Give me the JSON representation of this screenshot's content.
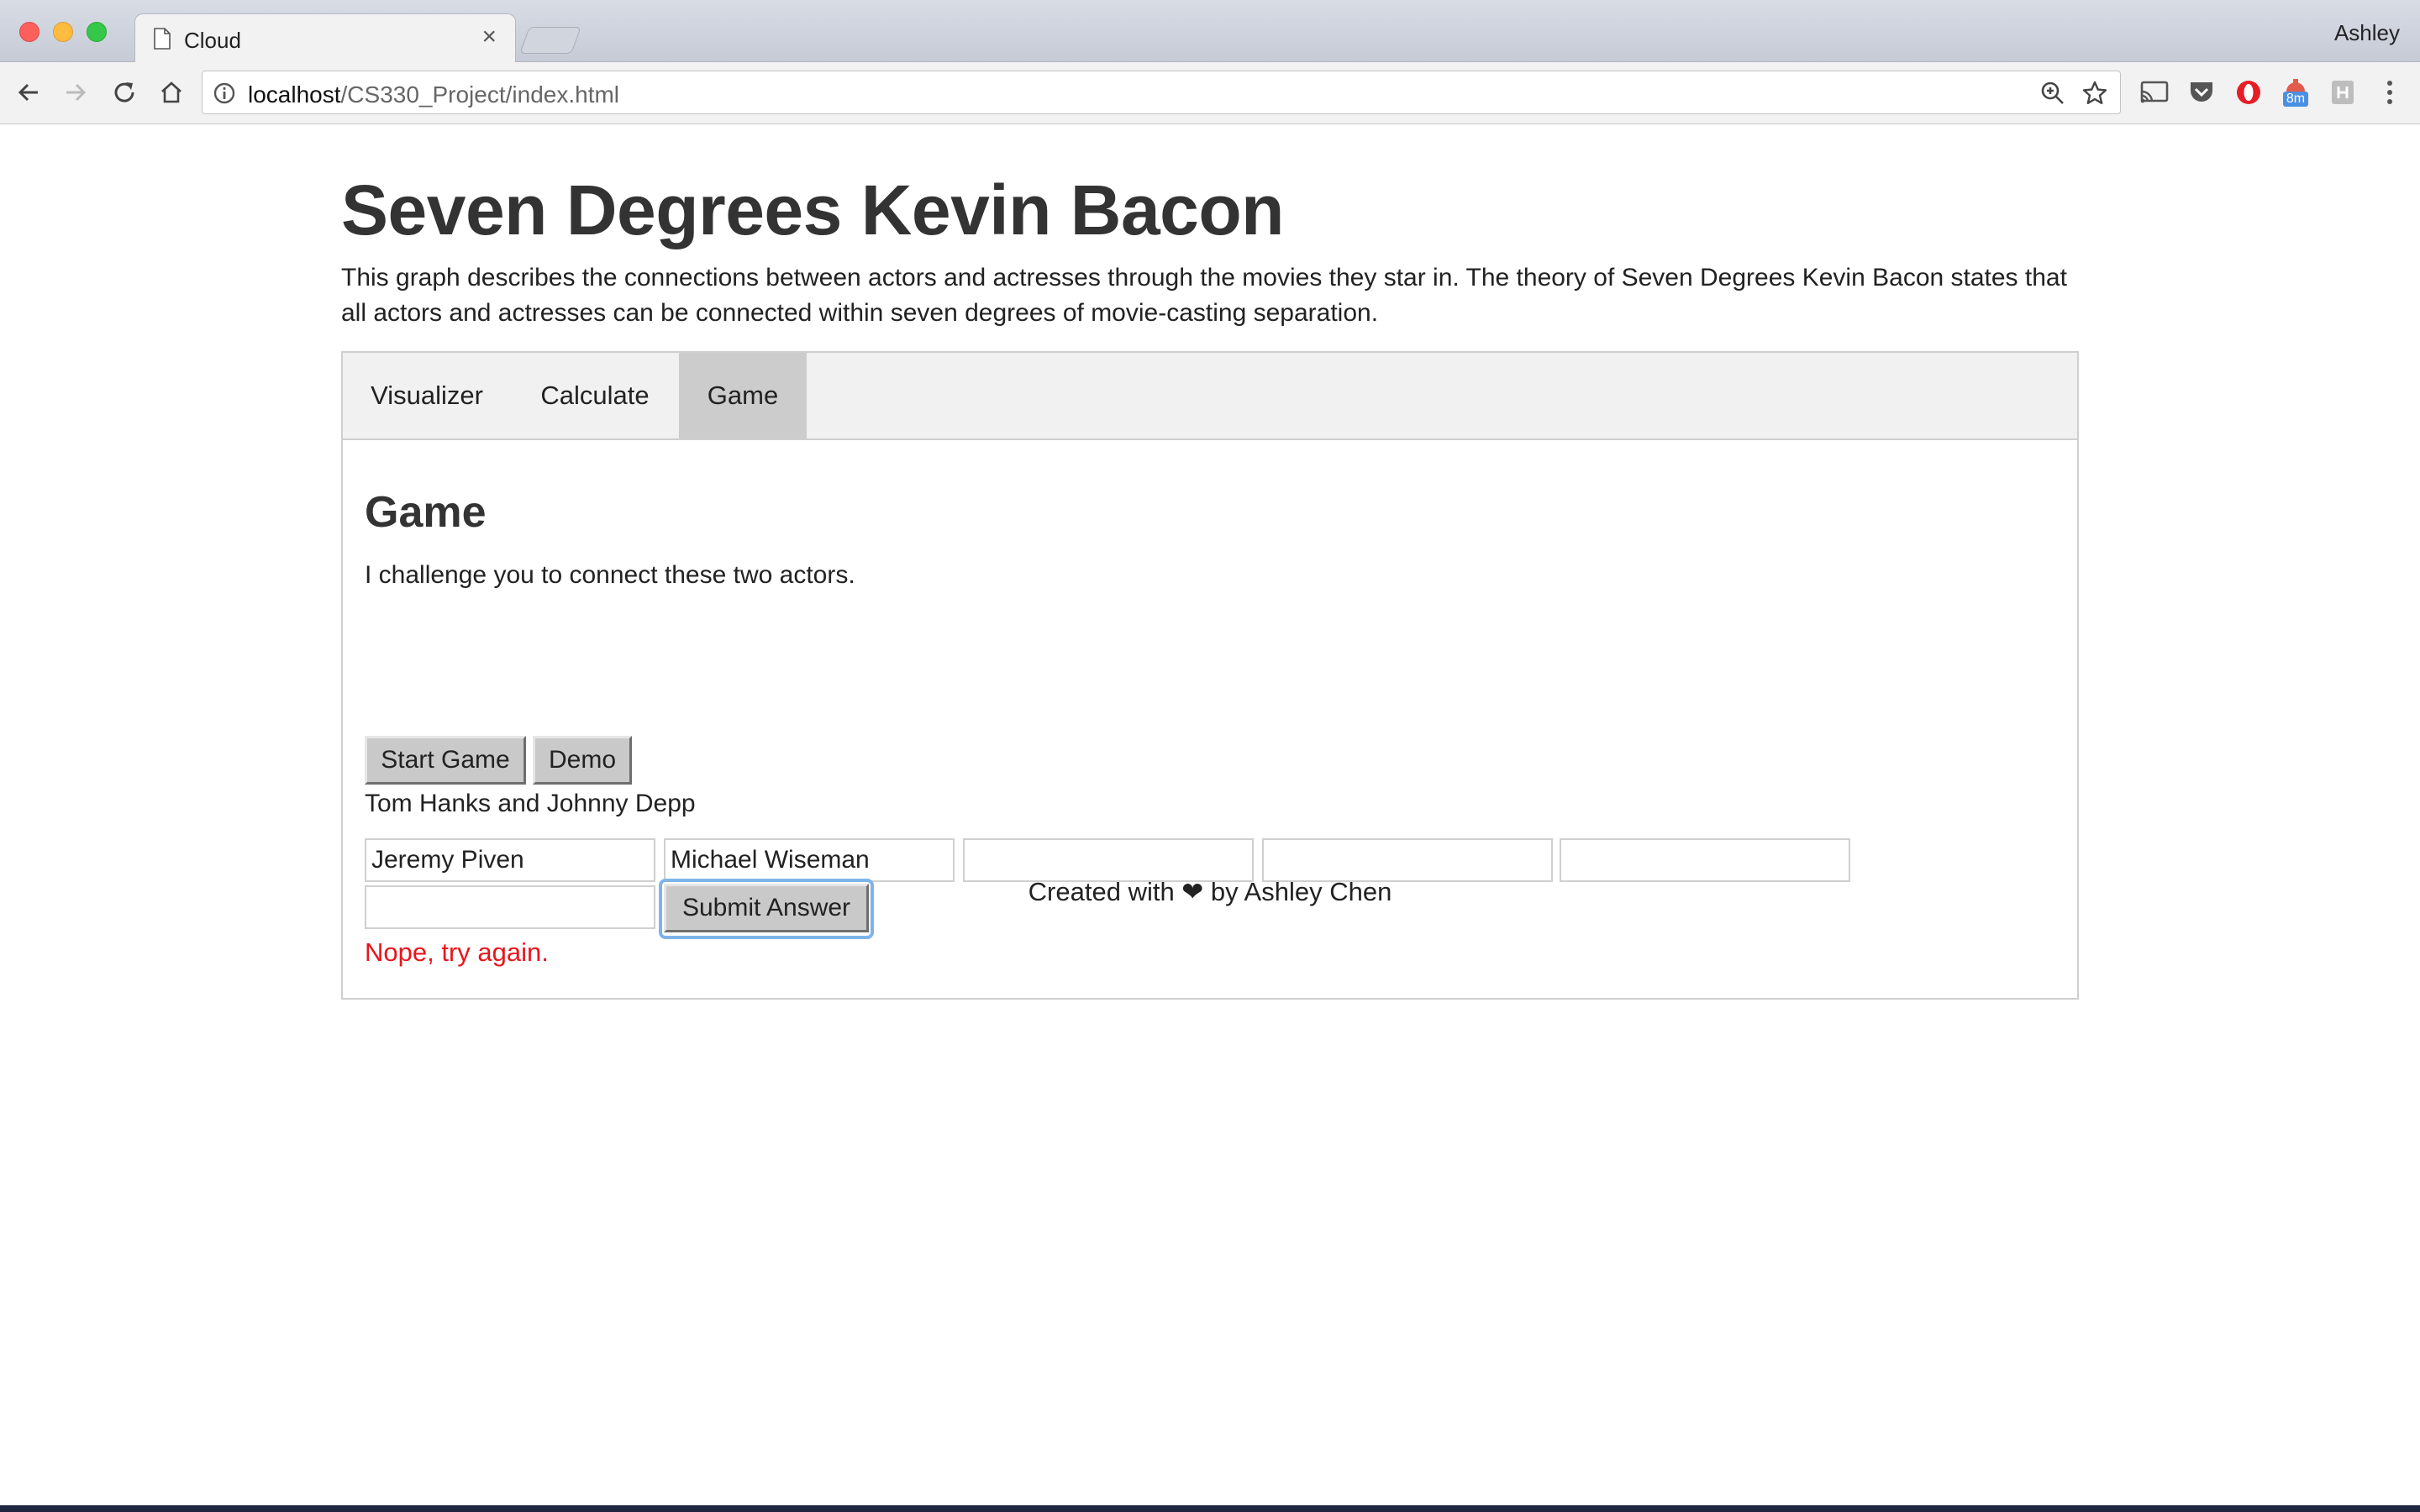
{
  "browser": {
    "tab_title": "Cloud",
    "tab_close": "×",
    "profile_name": "Ashley",
    "url_host": "localhost",
    "url_path": "/CS330_Project/index.html",
    "extension_badge": "8m",
    "badge_color": "#4a90e2"
  },
  "page": {
    "title": "Seven Degrees Kevin Bacon",
    "intro": "This graph describes the connections between actors and actresses through the movies they star in. The theory of Seven Degrees Kevin Bacon states that all actors and actresses can be connected within seven degrees of movie-casting separation.",
    "tabs": [
      {
        "label": "Visualizer",
        "active": false
      },
      {
        "label": "Calculate",
        "active": false
      },
      {
        "label": "Game",
        "active": true
      }
    ],
    "game": {
      "heading": "Game",
      "description": "I challenge you to connect these two actors.",
      "start_button": "Start Game",
      "demo_button": "Demo",
      "pair": "Tom Hanks and Johnny Depp",
      "answers": [
        "Jeremy Piven",
        "Michael Wiseman",
        "",
        "",
        "",
        ""
      ],
      "submit_button": "Submit Answer",
      "feedback": "Nope, try again.",
      "feedback_color": "#e8161c"
    },
    "footer": "Created with ❤ by Ashley Chen"
  }
}
